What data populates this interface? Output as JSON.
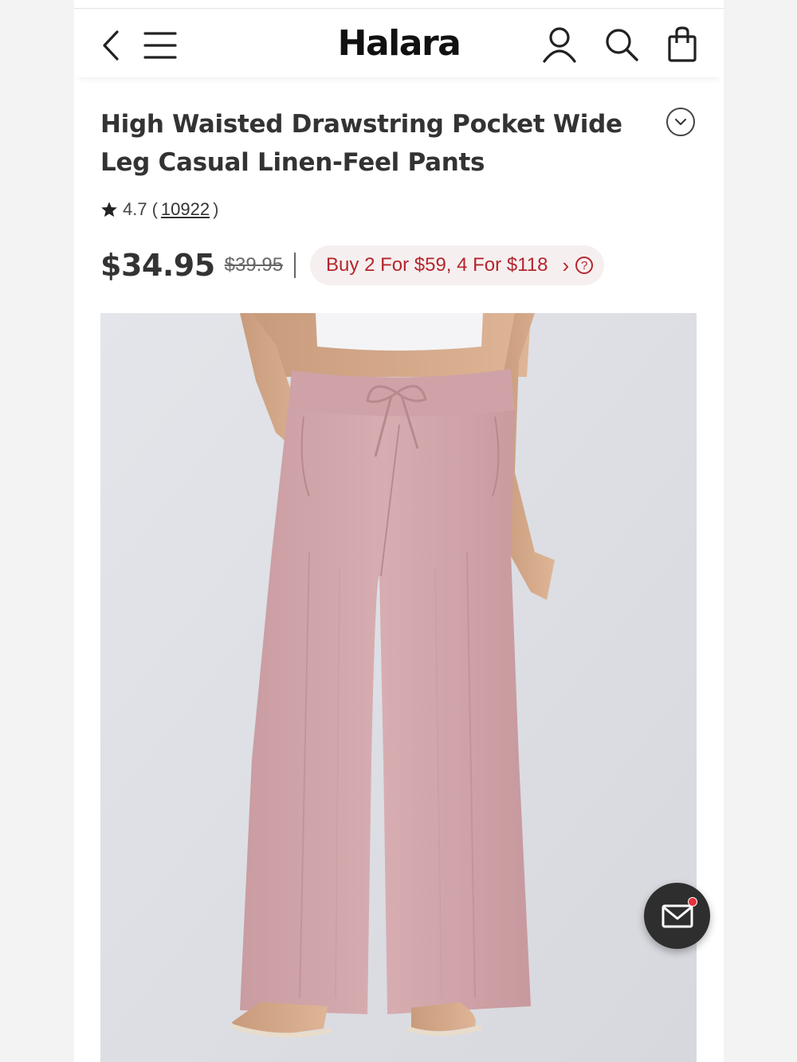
{
  "header": {
    "brand": "Halara",
    "back_icon": "chevron-left-icon",
    "menu_icon": "hamburger-menu-icon",
    "account_icon": "user-icon",
    "search_icon": "search-icon",
    "bag_icon": "shopping-bag-icon"
  },
  "product": {
    "title": "High Waisted Drawstring Pocket Wide Leg Casual Linen-Feel Pants",
    "rating": "4.7",
    "review_count": "10922",
    "price": "$34.95",
    "original_price": "$39.95",
    "promo": "Buy 2 For $59, 4 For $118",
    "image_alt": "Pink wide leg linen-feel pants",
    "pants_color": "#d4a9ad"
  },
  "colors": {
    "promo_text": "#b3262e",
    "promo_bg": "#f6efef",
    "fab_bg": "#2e2e2e",
    "notification_dot": "#e6323c"
  },
  "fab": {
    "icon": "mail-icon"
  }
}
